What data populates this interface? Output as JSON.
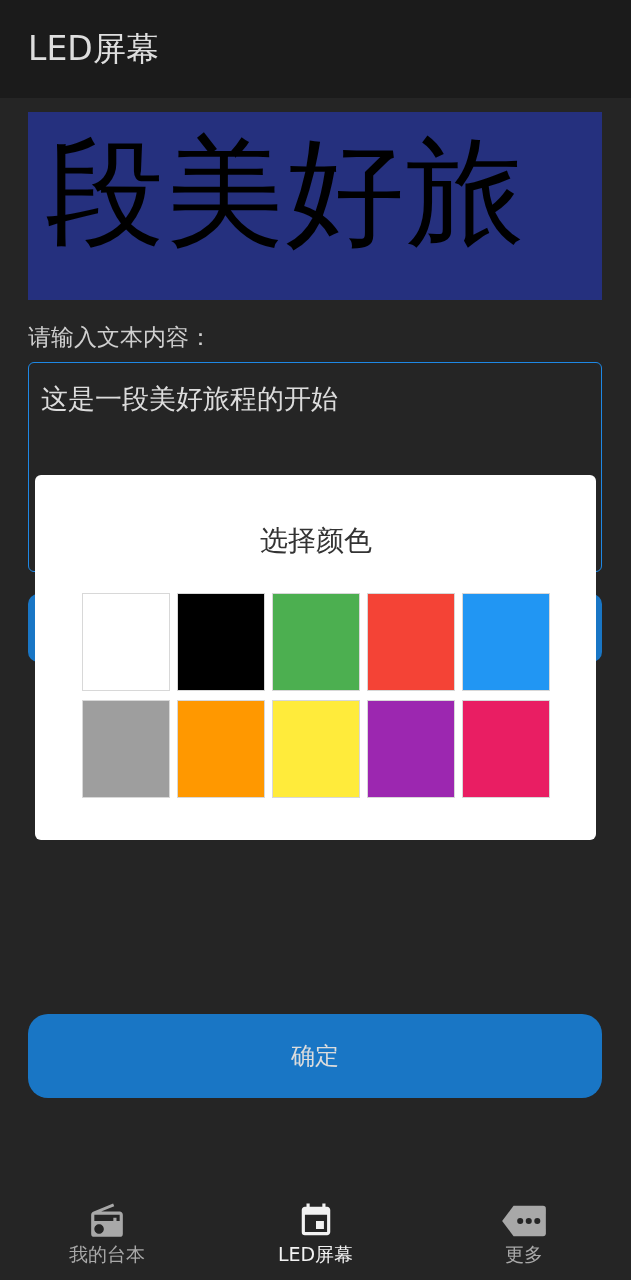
{
  "app_bar": {
    "title": "LED屏幕"
  },
  "led_display": {
    "text": "段美好旅"
  },
  "text_input": {
    "label": "请输入文本内容：",
    "value": "这是一段美好旅程的开始"
  },
  "color_dialog": {
    "title": "选择颜色",
    "colors": [
      {
        "color": "#ffffff"
      },
      {
        "color": "#000000"
      },
      {
        "color": "#4caf50"
      },
      {
        "color": "#f44336"
      },
      {
        "color": "#2196f3"
      },
      {
        "color": "#9e9e9e"
      },
      {
        "color": "#ff9800"
      },
      {
        "color": "#ffeb3b"
      },
      {
        "color": "#9c27b0"
      },
      {
        "color": "#e91e63"
      }
    ]
  },
  "confirm_button": {
    "label": "确定"
  },
  "bottom_nav": [
    {
      "kind": "radio",
      "label": "我的台本",
      "selected": false
    },
    {
      "kind": "calendar",
      "label": "LED屏幕",
      "selected": true
    },
    {
      "kind": "more",
      "label": "更多",
      "selected": false
    }
  ]
}
